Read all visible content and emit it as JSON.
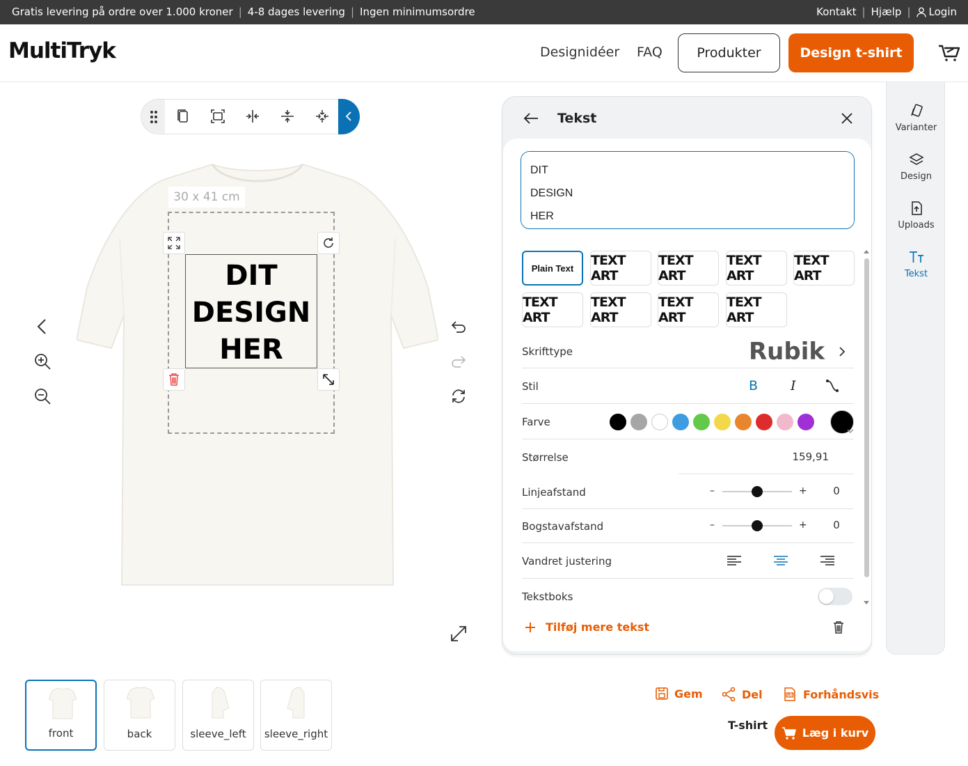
{
  "topbar": {
    "promo1": "Gratis levering på ordre over 1.000 kroner",
    "promo2": "4-8 dages levering",
    "promo3": "Ingen minimumsordre",
    "contact": "Kontakt",
    "help": "Hjælp",
    "login": "Login"
  },
  "header": {
    "logo": "MultiTryk",
    "nav_ideas": "Designidéer",
    "nav_faq": "FAQ",
    "btn_products": "Produkter",
    "btn_design": "Design t-shirt"
  },
  "canvas": {
    "size_label": "30 x 41 cm",
    "design_line1": "DIT",
    "design_line2": "DESIGN",
    "design_line3": "HER",
    "shirt_color": "#f7f6f1"
  },
  "views": [
    {
      "label": "front",
      "selected": true
    },
    {
      "label": "back",
      "selected": false
    },
    {
      "label": "sleeve_left",
      "selected": false
    },
    {
      "label": "sleeve_right",
      "selected": false
    }
  ],
  "panel": {
    "title": "Tekst",
    "text_value": "DIT\nDESIGN\nHER",
    "styles": [
      "Plain Text",
      "TEXT ART",
      "TEXT ART",
      "TEXT ART",
      "TEXT ART",
      "TEXT ART",
      "TEXT ART",
      "TEXT ART",
      "TEXT ART"
    ],
    "font_label": "Skrifttype",
    "font_value": "Rubik",
    "style_label": "Stil",
    "bold_label": "B",
    "italic_label": "I",
    "color_label": "Farve",
    "colors": [
      "#000000",
      "#a6a6a6",
      "#ffffff",
      "#3d9de0",
      "#62c94a",
      "#f3d849",
      "#e8862e",
      "#de2c2c",
      "#f2b8cc",
      "#a02fd6"
    ],
    "selected_color": "#000000",
    "size_label": "Størrelse",
    "size_value": "159,91",
    "line_label": "Linjeafstand",
    "line_value": "0",
    "letter_label": "Bogstavafstand",
    "letter_value": "0",
    "minus": "–",
    "plus": "+",
    "align_label": "Vandret justering",
    "textbox_label": "Tekstboks",
    "add_more": "Tilføj mere tekst"
  },
  "sidebar": {
    "items": [
      {
        "label": "Varianter",
        "active": false
      },
      {
        "label": "Design",
        "active": false
      },
      {
        "label": "Uploads",
        "active": false
      },
      {
        "label": "Tekst",
        "active": true
      }
    ]
  },
  "actions": {
    "save": "Gem",
    "share": "Del",
    "preview": "Forhåndsvis",
    "product_name": "T-shirt",
    "add_to_cart": "Læg i kurv"
  },
  "colors": {
    "accent": "#e85d04",
    "primary": "#0a72b4"
  }
}
